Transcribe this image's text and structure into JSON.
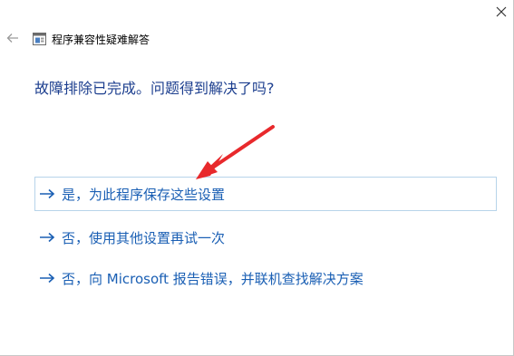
{
  "window": {
    "title": "程序兼容性疑难解答"
  },
  "heading": "故障排除已完成。问题得到解决了吗?",
  "options": [
    {
      "label": "是，为此程序保存这些设置"
    },
    {
      "label": "否，使用其他设置再试一次"
    },
    {
      "label": "否，向 Microsoft 报告错误，并联机查找解决方案"
    }
  ],
  "colors": {
    "link": "#1a5fb4",
    "heading": "#1d3f8f",
    "selected_border": "#b7d4ea",
    "annotation_arrow": "#e8292c"
  },
  "icons": {
    "close": "close-icon",
    "back": "back-arrow-icon",
    "app": "compatibility-troubleshooter-icon",
    "option_arrow": "right-arrow-icon"
  }
}
